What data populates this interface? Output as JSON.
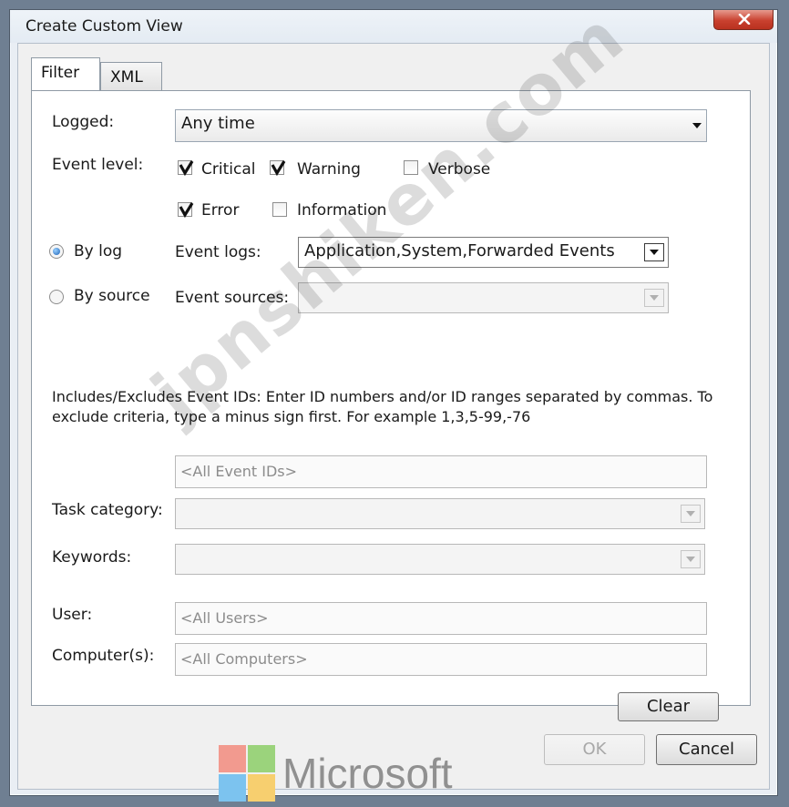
{
  "window": {
    "title": "Create Custom View"
  },
  "tabs": [
    {
      "label": "Filter",
      "active": true
    },
    {
      "label": "XML",
      "active": false
    }
  ],
  "filter": {
    "logged": {
      "label": "Logged:",
      "value": "Any time"
    },
    "event_level": {
      "label": "Event level:",
      "options": [
        {
          "label": "Critical",
          "checked": true
        },
        {
          "label": "Warning",
          "checked": true
        },
        {
          "label": "Verbose",
          "checked": false
        },
        {
          "label": "Error",
          "checked": true
        },
        {
          "label": "Information",
          "checked": false
        }
      ]
    },
    "by_log": {
      "label": "By log",
      "selected": true
    },
    "by_source": {
      "label": "By source",
      "selected": false
    },
    "event_logs": {
      "label": "Event logs:",
      "value": "Application,System,Forwarded Events"
    },
    "event_sources": {
      "label": "Event sources:",
      "value": ""
    },
    "description": "Includes/Excludes Event IDs: Enter ID numbers and/or ID ranges separated by commas. To exclude criteria, type a minus sign first. For example 1,3,5-99,-76",
    "event_ids": {
      "placeholder": "<All Event IDs>"
    },
    "task_category": {
      "label": "Task category:",
      "value": ""
    },
    "keywords": {
      "label": "Keywords:",
      "value": ""
    },
    "user": {
      "label": "User:",
      "placeholder": "<All Users>"
    },
    "computers": {
      "label": "Computer(s):",
      "placeholder": "<All Computers>"
    },
    "clear_label": "Clear"
  },
  "footer": {
    "ok_label": "OK",
    "cancel_label": "Cancel"
  },
  "overlay": {
    "watermark": "jpnshiken.com",
    "logo_text": "Microsoft"
  },
  "icons": {
    "close": "close-icon",
    "dropdown": "chevron-down-icon",
    "checkmark": "checkmark-icon",
    "microsoft_logo": "microsoft-logo-icon"
  },
  "colors": {
    "close_button": "#c9412f",
    "radio_selected": "#1c62b6",
    "logo_red": "#f25022",
    "logo_green": "#7fba00",
    "logo_blue": "#00a4ef",
    "logo_yellow": "#ffb900"
  }
}
